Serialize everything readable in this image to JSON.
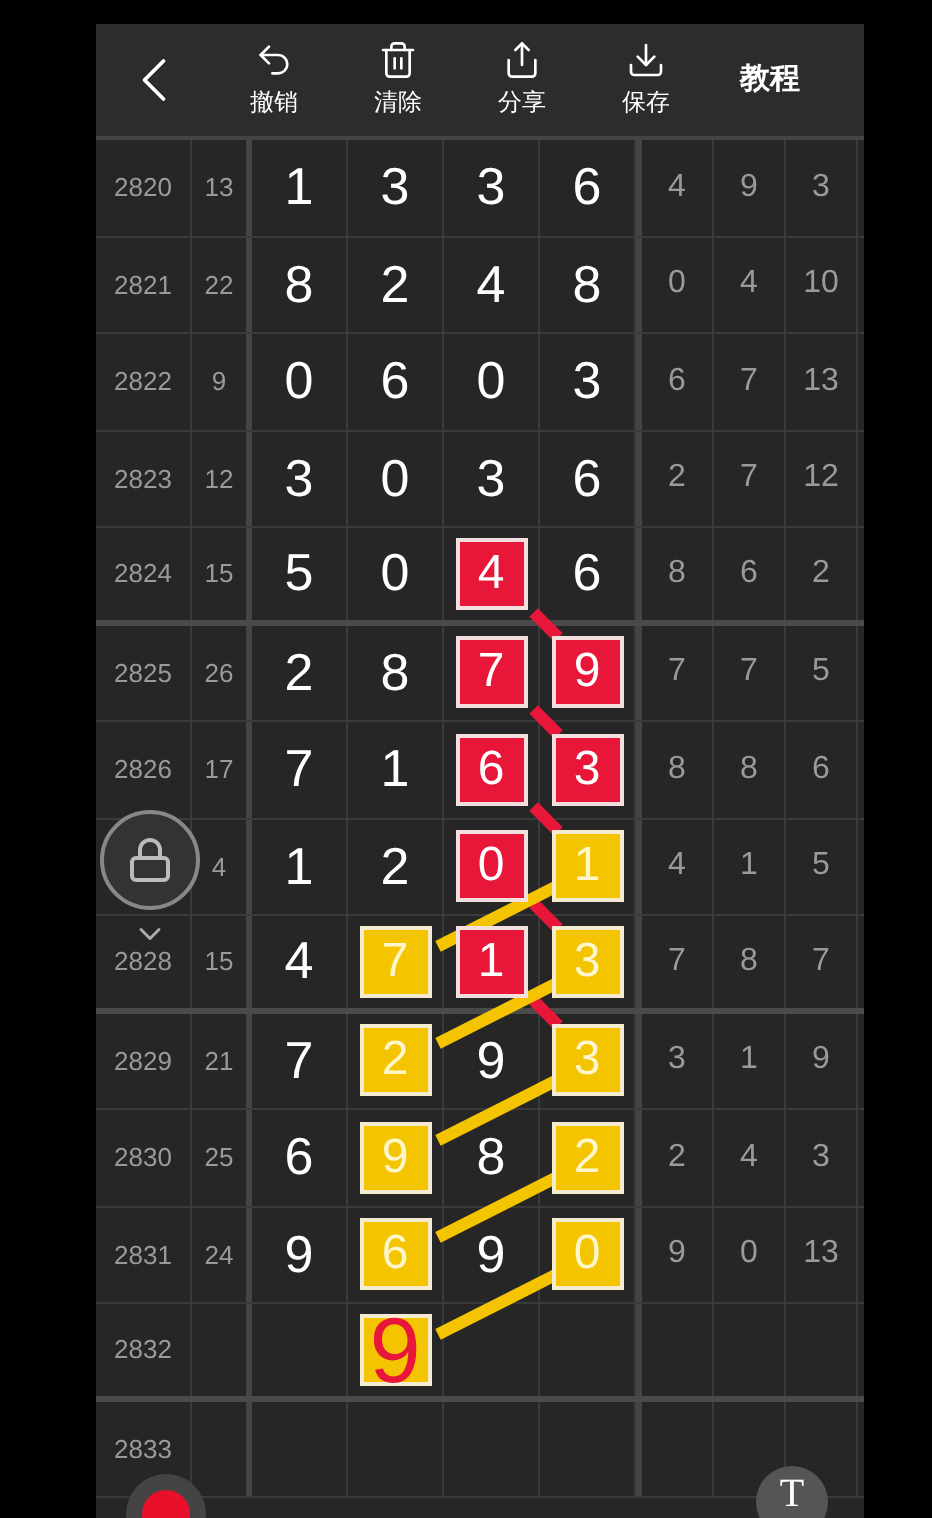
{
  "toolbar": {
    "actions": [
      {
        "label": "撤销"
      },
      {
        "label": "清除"
      },
      {
        "label": "分享"
      },
      {
        "label": "保存"
      }
    ],
    "tutorial": "教程"
  },
  "rows": [
    {
      "period": "2820",
      "sum": "13",
      "digits": [
        {
          "value": "1",
          "kind": "plain"
        },
        {
          "value": "3",
          "kind": "plain"
        },
        {
          "value": "3",
          "kind": "plain"
        },
        {
          "value": "6",
          "kind": "plain"
        }
      ],
      "extras": [
        "4",
        "9",
        "3"
      ]
    },
    {
      "period": "2821",
      "sum": "22",
      "digits": [
        {
          "value": "8",
          "kind": "plain"
        },
        {
          "value": "2",
          "kind": "plain"
        },
        {
          "value": "4",
          "kind": "plain"
        },
        {
          "value": "8",
          "kind": "plain"
        }
      ],
      "extras": [
        "0",
        "4",
        "10"
      ]
    },
    {
      "period": "2822",
      "sum": "9",
      "digits": [
        {
          "value": "0",
          "kind": "plain"
        },
        {
          "value": "6",
          "kind": "plain"
        },
        {
          "value": "0",
          "kind": "plain"
        },
        {
          "value": "3",
          "kind": "plain"
        }
      ],
      "extras": [
        "6",
        "7",
        "13"
      ]
    },
    {
      "period": "2823",
      "sum": "12",
      "digits": [
        {
          "value": "3",
          "kind": "plain"
        },
        {
          "value": "0",
          "kind": "plain"
        },
        {
          "value": "3",
          "kind": "plain"
        },
        {
          "value": "6",
          "kind": "plain"
        }
      ],
      "extras": [
        "2",
        "7",
        "12"
      ]
    },
    {
      "period": "2824",
      "sum": "15",
      "digits": [
        {
          "value": "5",
          "kind": "plain"
        },
        {
          "value": "0",
          "kind": "plain"
        },
        {
          "value": "4",
          "kind": "red",
          "linked": true
        },
        {
          "value": "6",
          "kind": "plain"
        }
      ],
      "extras": [
        "8",
        "6",
        "2"
      ]
    },
    {
      "period": "2825",
      "sum": "26",
      "digits": [
        {
          "value": "2",
          "kind": "plain"
        },
        {
          "value": "8",
          "kind": "plain"
        },
        {
          "value": "7",
          "kind": "red",
          "linked": true
        },
        {
          "value": "9",
          "kind": "red"
        }
      ],
      "extras": [
        "7",
        "7",
        "5"
      ]
    },
    {
      "period": "2826",
      "sum": "17",
      "digits": [
        {
          "value": "7",
          "kind": "plain"
        },
        {
          "value": "1",
          "kind": "plain"
        },
        {
          "value": "6",
          "kind": "red",
          "linked": true
        },
        {
          "value": "3",
          "kind": "red"
        }
      ],
      "extras": [
        "8",
        "8",
        "6"
      ]
    },
    {
      "sum": "4",
      "digits": [
        {
          "value": "1",
          "kind": "plain"
        },
        {
          "value": "2",
          "kind": "plain"
        },
        {
          "value": "0",
          "kind": "red",
          "linked": true
        },
        {
          "value": "1",
          "kind": "yellow",
          "linked": true
        }
      ],
      "extras": [
        "4",
        "1",
        "5"
      ]
    },
    {
      "period": "2828",
      "sum": "15",
      "digits": [
        {
          "value": "4",
          "kind": "plain"
        },
        {
          "value": "7",
          "kind": "yellow"
        },
        {
          "value": "1",
          "kind": "red",
          "linked": true
        },
        {
          "value": "3",
          "kind": "yellow",
          "linked": true
        }
      ],
      "extras": [
        "7",
        "8",
        "7"
      ]
    },
    {
      "period": "2829",
      "sum": "21",
      "digits": [
        {
          "value": "7",
          "kind": "plain"
        },
        {
          "value": "2",
          "kind": "yellow"
        },
        {
          "value": "9",
          "kind": "plain"
        },
        {
          "value": "3",
          "kind": "yellow",
          "linked": true
        }
      ],
      "extras": [
        "3",
        "1",
        "9"
      ]
    },
    {
      "period": "2830",
      "sum": "25",
      "digits": [
        {
          "value": "6",
          "kind": "plain"
        },
        {
          "value": "9",
          "kind": "yellow"
        },
        {
          "value": "8",
          "kind": "plain"
        },
        {
          "value": "2",
          "kind": "yellow",
          "linked": true
        }
      ],
      "extras": [
        "2",
        "4",
        "3"
      ]
    },
    {
      "period": "2831",
      "sum": "24",
      "digits": [
        {
          "value": "9",
          "kind": "plain"
        },
        {
          "value": "6",
          "kind": "yellow"
        },
        {
          "value": "9",
          "kind": "plain"
        },
        {
          "value": "0",
          "kind": "yellow",
          "linked": true
        }
      ],
      "extras": [
        "9",
        "0",
        "13"
      ]
    },
    {
      "period": "2832",
      "digits": [
        {
          "kind": "empty"
        },
        {
          "value": "9",
          "kind": "guess"
        },
        {
          "kind": "empty"
        },
        {
          "kind": "empty"
        }
      ]
    },
    {
      "period": "2833",
      "digits": [
        {
          "kind": "empty"
        },
        {
          "kind": "empty"
        },
        {
          "kind": "empty"
        },
        {
          "kind": "empty"
        }
      ]
    }
  ],
  "text_tool": "T"
}
